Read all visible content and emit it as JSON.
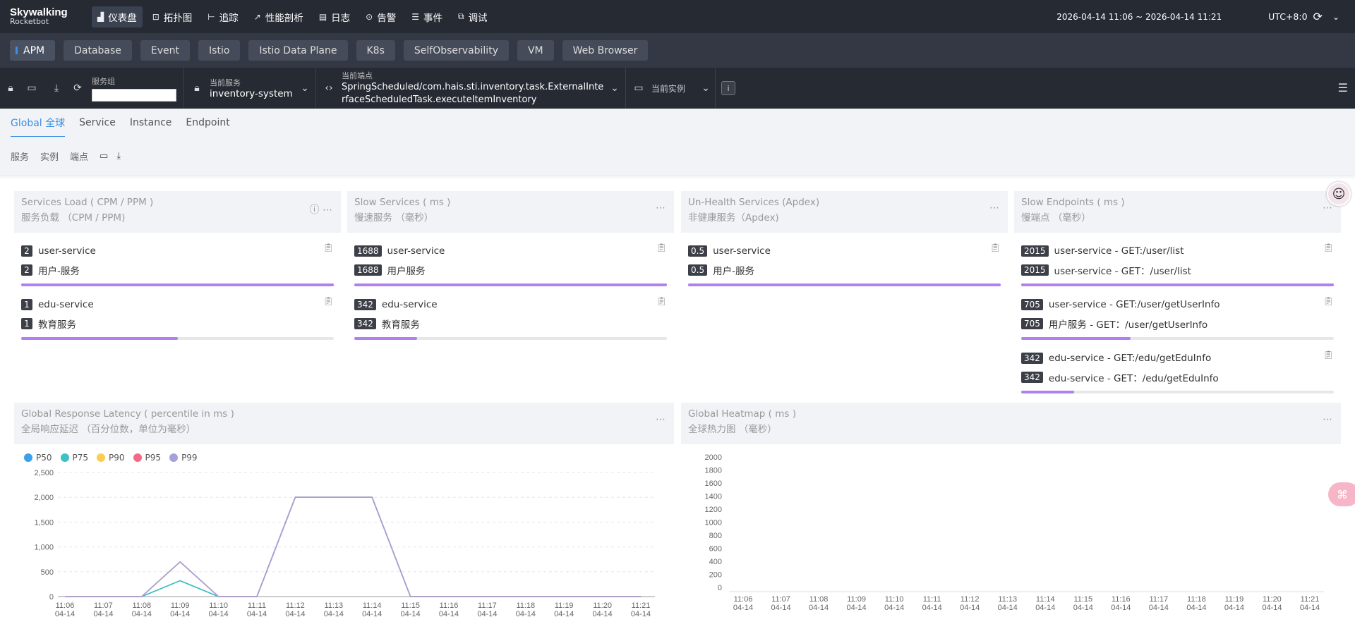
{
  "app": {
    "logo_line1": "Skywalking",
    "logo_line2": "Rocketbot"
  },
  "nav": {
    "items": [
      {
        "label": "仪表盘",
        "icon": "dashboard-icon",
        "glyph": "▟",
        "active": true
      },
      {
        "label": "拓扑图",
        "icon": "topology-icon",
        "glyph": "⊡"
      },
      {
        "label": "追踪",
        "icon": "trace-icon",
        "glyph": "⊢"
      },
      {
        "label": "性能剖析",
        "icon": "profile-icon",
        "glyph": "↗"
      },
      {
        "label": "日志",
        "icon": "log-icon",
        "glyph": "▤"
      },
      {
        "label": "告警",
        "icon": "alarm-icon",
        "glyph": "⊙"
      },
      {
        "label": "事件",
        "icon": "event-icon",
        "glyph": "☰"
      },
      {
        "label": "调试",
        "icon": "debug-icon",
        "glyph": "⧉"
      }
    ],
    "time_range": "2026-04-14 11:06 ~ 2026-04-14 11:21",
    "timezone": "UTC+8:0"
  },
  "layers": [
    "APM",
    "Database",
    "Event",
    "Istio",
    "Istio Data Plane",
    "K8s",
    "SelfObservability",
    "VM",
    "Web Browser"
  ],
  "selectors": {
    "group_label": "服务组",
    "group_value": "",
    "service_label": "当前服务",
    "service_value": "inventory-system",
    "endpoint_label": "当前端点",
    "endpoint_value_line1": "SpringScheduled/com.hais.sti.inventory.task.ExternalInte",
    "endpoint_value_line2": "rfaceScheduledTask.executeItemInventory",
    "instance_label": "当前实例"
  },
  "tabs": [
    "Global 全球",
    "Service",
    "Instance",
    "Endpoint"
  ],
  "subtools": [
    "服务",
    "实例",
    "端点"
  ],
  "cards": {
    "load": {
      "title": "Services Load ( CPM / PPM )",
      "subtitle": "服务负载 （CPM / PPM)",
      "groups": [
        {
          "rows": [
            {
              "badge": "2",
              "text": "user-service"
            },
            {
              "badge": "2",
              "text": "用户-服务"
            }
          ],
          "fill": 1.0
        },
        {
          "rows": [
            {
              "badge": "1",
              "text": "edu-service"
            },
            {
              "badge": "1",
              "text": "教育服务"
            }
          ],
          "fill": 0.5
        }
      ]
    },
    "slow": {
      "title": "Slow Services ( ms )",
      "subtitle": "慢速服务 （毫秒）",
      "groups": [
        {
          "rows": [
            {
              "badge": "1688",
              "text": "user-service"
            },
            {
              "badge": "1688",
              "text": "用户服务"
            }
          ],
          "fill": 1.0
        },
        {
          "rows": [
            {
              "badge": "342",
              "text": "edu-service"
            },
            {
              "badge": "342",
              "text": "教育服务"
            }
          ],
          "fill": 0.2
        }
      ]
    },
    "unhealth": {
      "title": "Un-Health Services (Apdex)",
      "subtitle": "非健康服务（Apdex)",
      "groups": [
        {
          "rows": [
            {
              "badge": "0.5",
              "text": "user-service"
            },
            {
              "badge": "0.5",
              "text": "用户-服务"
            }
          ],
          "fill": 1.0
        }
      ]
    },
    "endpoints": {
      "title": "Slow Endpoints ( ms )",
      "subtitle": "慢端点 （毫秒）",
      "groups": [
        {
          "rows": [
            {
              "badge": "2015",
              "text": "user-service - GET:/user/list"
            },
            {
              "badge": "2015",
              "text": "user-service - GET：/user/list"
            }
          ],
          "fill": 1.0
        },
        {
          "rows": [
            {
              "badge": "705",
              "text": "user-service - GET:/user/getUserInfo"
            },
            {
              "badge": "705",
              "text": "用户服务 - GET：/user/getUserInfo"
            }
          ],
          "fill": 0.35
        },
        {
          "rows": [
            {
              "badge": "342",
              "text": "edu-service - GET:/edu/getEduInfo"
            },
            {
              "badge": "342",
              "text": "edu-service - GET：/edu/getEduInfo"
            }
          ],
          "fill": 0.17
        }
      ]
    },
    "latency": {
      "title": "Global Response Latency ( percentile in ms )",
      "subtitle": "全局响应延迟 （百分位数，单位为毫秒）"
    },
    "heatmap": {
      "title": "Global Heatmap ( ms )",
      "subtitle": "全球热力图 （毫秒）"
    }
  },
  "chart_data": [
    {
      "type": "line",
      "x": [
        "11:06",
        "11:07",
        "11:08",
        "11:09",
        "11:10",
        "11:11",
        "11:12",
        "11:13",
        "11:14",
        "11:15",
        "11:16",
        "11:17",
        "11:18",
        "11:19",
        "11:20",
        "11:21"
      ],
      "x_sub": "04-14",
      "ylim": [
        0,
        2500
      ],
      "yticks": [
        "2,500",
        "2,000",
        "1,500",
        "1,000",
        "500",
        "0"
      ],
      "grid": true,
      "legend_position": "top-left",
      "series": [
        {
          "name": "P50",
          "color": "#3ba1e8",
          "values": [
            0,
            0,
            0,
            320,
            0,
            0,
            2000,
            2000,
            2000,
            0,
            0,
            0,
            0,
            0,
            0,
            0
          ]
        },
        {
          "name": "P75",
          "color": "#3ec1c0",
          "values": [
            0,
            0,
            0,
            320,
            0,
            0,
            2000,
            2000,
            2000,
            0,
            0,
            0,
            0,
            0,
            0,
            0
          ]
        },
        {
          "name": "P90",
          "color": "#fbcd50",
          "values": [
            0,
            0,
            0,
            700,
            0,
            0,
            2000,
            2000,
            2000,
            0,
            0,
            0,
            0,
            0,
            0,
            0
          ]
        },
        {
          "name": "P95",
          "color": "#f46a86",
          "values": [
            0,
            0,
            0,
            700,
            0,
            0,
            2000,
            2000,
            2000,
            0,
            0,
            0,
            0,
            0,
            0,
            0
          ]
        },
        {
          "name": "P99",
          "color": "#a5a1dc",
          "values": [
            0,
            0,
            0,
            700,
            0,
            0,
            2000,
            2000,
            2000,
            0,
            0,
            0,
            0,
            0,
            0,
            0
          ]
        }
      ]
    },
    {
      "type": "heatmap",
      "x": [
        "11:06",
        "11:07",
        "11:08",
        "11:09",
        "11:10",
        "11:11",
        "11:12",
        "11:13",
        "11:14",
        "11:15",
        "11:16",
        "11:17",
        "11:18",
        "11:19",
        "11:20",
        "11:21"
      ],
      "x_sub": "04-14",
      "yticks": [
        "2000",
        "1800",
        "1600",
        "1400",
        "1200",
        "1000",
        "800",
        "600",
        "400",
        "200",
        "0"
      ],
      "values": []
    }
  ]
}
